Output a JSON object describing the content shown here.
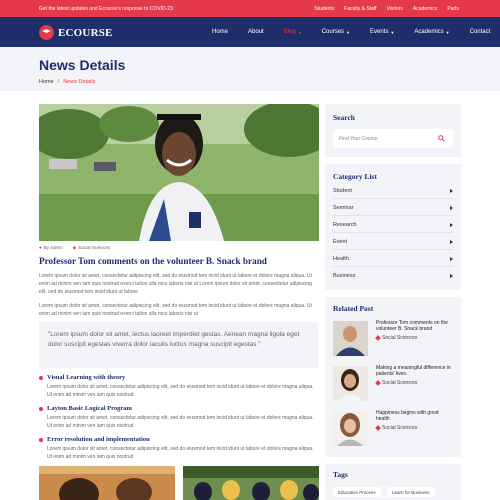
{
  "topbar": {
    "message": "Get the latest updates and Ecourse's response to COVID-23",
    "links": [
      "Students",
      "Faculty & Staff",
      "Visitors",
      "Academics",
      "Parts"
    ]
  },
  "nav": {
    "logo": "ECOURSE",
    "items": [
      {
        "label": "Home",
        "dropdown": false,
        "active": false
      },
      {
        "label": "About",
        "dropdown": false,
        "active": false
      },
      {
        "label": "Blog",
        "dropdown": true,
        "active": true
      },
      {
        "label": "Courses",
        "dropdown": true,
        "active": false
      },
      {
        "label": "Events",
        "dropdown": true,
        "active": false
      },
      {
        "label": "Academics",
        "dropdown": true,
        "active": false
      },
      {
        "label": "Contact",
        "dropdown": false,
        "active": false
      }
    ]
  },
  "banner": {
    "title": "News Details",
    "breadcrumb": {
      "home": "Home",
      "separator": "/",
      "current": "News Details"
    }
  },
  "post": {
    "author": "By Admin",
    "category": "Social Sciences",
    "title": "Professor Tom comments on the volunteer B. Snack brand",
    "para1": "Lorem ipsum dolor sit amet, consectetur adipiscing elit, sed do eiusmod tem incid idunt ut labore et dolore magna aliqua. Ut enim ad minim ven iam quis nostrud exerci tation ulla mco laboris nisi ut Lorem ipsum dolor sit amet, consectetur adipiscing elit, sed do eiusmod tem incid idunt ut labore",
    "para2": "Lorem ipsum dolor sit amet, consectetur adipiscing elit, sed do eiusmod tem incid idunt ut labore et dolore magna aliqua. Ut enim ad minim ven iam quis nostrud exerci tation ulla mco laboris nisi ut",
    "quote": "\"Lorem ipsum dolor sit amet, lectus laoreet imperdiet gestas. Aenean magna ligula eget dolor suscipit egestas viverra dolor iaculis luctus magna suscipit egestas \"",
    "sections": [
      {
        "heading": "Visual Learning with theory",
        "text": "Lorem ipsum dolor sit amet, consectetur adipiscing elit, sed do eiusmod tem incid idunt ut labore et dolore magna aliqua. Ut enim ad minim ven iam quis nostrud"
      },
      {
        "heading": "Layton Basic Logical Program",
        "text": "Lorem ipsum dolor sit amet, consectetur adipiscing elit, sed do eiusmod tem incid idunt ut labore et dolore magna aliqua. Ut enim ad minim ven iam quis nostrud"
      },
      {
        "heading": "Error resolution and implementation",
        "text": "Lorem ipsum dolor sit amet, consectetur adipiscing elit, sed do eiusmod tem incid idunt ut labore et dolore magna aliqua. Ut enim ad minim ven iam quis nostrud"
      }
    ]
  },
  "sidebar": {
    "search": {
      "title": "Search",
      "placeholder": "Find Your Course"
    },
    "categories": {
      "title": "Category List",
      "items": [
        "Student",
        "Seminar",
        "Research",
        "Event",
        "Health",
        "Business"
      ]
    },
    "related": {
      "title": "Related Post",
      "items": [
        {
          "title": "Professor Tom comments on the volunteer B. Snack brand",
          "tag": "Social Sciences"
        },
        {
          "title": "Making a meaningful difference in patients' lives.",
          "tag": "Social Sciences"
        },
        {
          "title": "Happiness begins with good health",
          "tag": "Social Sciences"
        }
      ]
    },
    "tags": {
      "title": "Tags",
      "items": [
        "Education Process",
        "Learn for Business"
      ]
    }
  },
  "colors": {
    "accent": "#e5384a",
    "navy": "#1d2e6b",
    "panel": "#f3f4f7"
  }
}
